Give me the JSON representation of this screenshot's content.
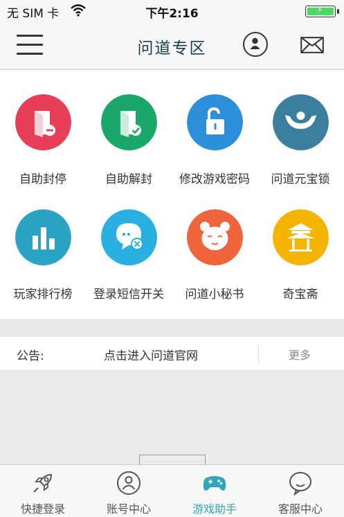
{
  "status_bar": {
    "carrier": "无 SIM 卡",
    "time": "下午2:16"
  },
  "nav": {
    "title": "问道专区"
  },
  "features": [
    {
      "label": "自助封停",
      "icon": "folder-minus-icon",
      "color": "#e83e5a"
    },
    {
      "label": "自助解封",
      "icon": "folder-check-icon",
      "color": "#1aa76b"
    },
    {
      "label": "修改游戏密码",
      "icon": "unlock-icon",
      "color": "#2c8fd9"
    },
    {
      "label": "问道元宝锁",
      "icon": "ingot-lock-icon",
      "color": "#3b7f9e"
    },
    {
      "label": "玩家排行榜",
      "icon": "bar-chart-icon",
      "color": "#2aa3c4"
    },
    {
      "label": "登录短信开关",
      "icon": "sms-toggle-icon",
      "color": "#2ab0e0"
    },
    {
      "label": "问道小秘书",
      "icon": "secretary-face-icon",
      "color": "#f0643c"
    },
    {
      "label": "奇宝斋",
      "icon": "pavilion-icon",
      "color": "#f5b400"
    }
  ],
  "notice": {
    "label": "公告:",
    "link": "点击进入问道官网",
    "more": "更多"
  },
  "tabs": [
    {
      "label": "快捷登录",
      "icon": "rocket-icon"
    },
    {
      "label": "账号中心",
      "icon": "user-circle-icon"
    },
    {
      "label": "游戏助手",
      "icon": "gamepad-icon",
      "active": true
    },
    {
      "label": "客服中心",
      "icon": "chat-bubble-icon"
    }
  ]
}
